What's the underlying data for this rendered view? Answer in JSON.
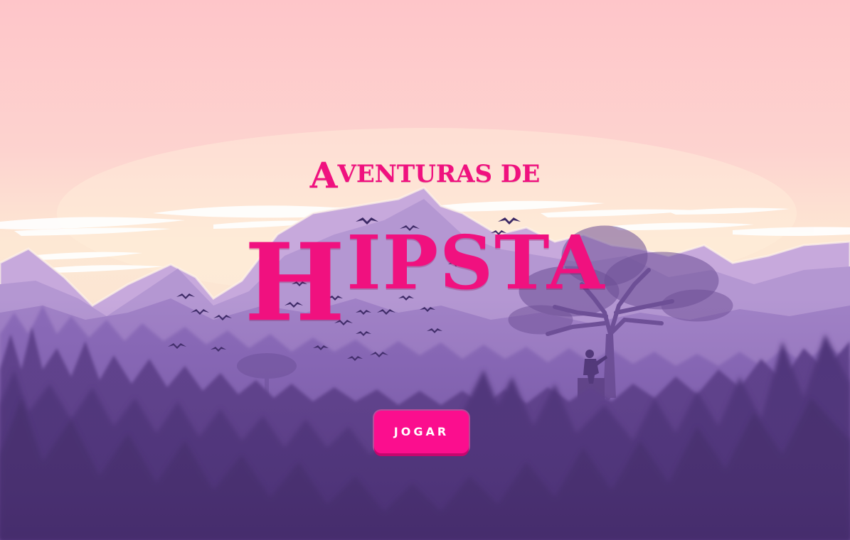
{
  "game": {
    "title_line1_initial": "A",
    "title_line1_rest": "VENTURAS DE",
    "title_line2_initial": "H",
    "title_line2_rest": "IPSTA",
    "play_label": "JOGAR"
  },
  "colors": {
    "title": "#f0117f",
    "button": "#fb0e8e",
    "button_shadow": "#c4076e",
    "button_text": "#ffffff",
    "sky_top": "#fec5c9",
    "sky_horizon": "#fde8d4",
    "forest_dark": "#4b2f73"
  },
  "background": {
    "scene": "purple-mountain-forest-sunset",
    "elements": [
      "mountains-icon",
      "clouds-icon",
      "birds-icon",
      "tree-icon",
      "pine-forest-icon",
      "hiker-silhouette-icon"
    ]
  }
}
